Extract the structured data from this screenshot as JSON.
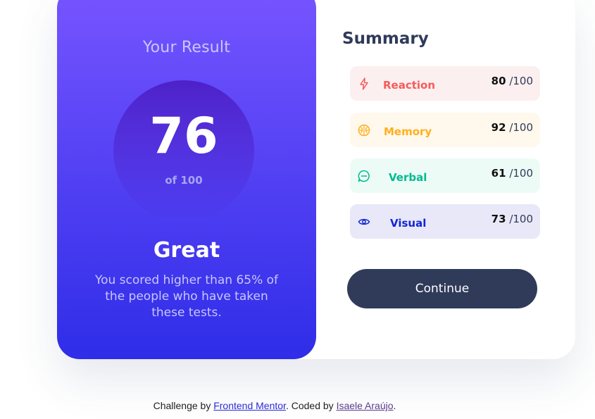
{
  "result": {
    "title": "Your Result",
    "score": "76",
    "max": "of 100",
    "label": "Great",
    "description": "You scored higher than 65% of the people who have taken these tests."
  },
  "summary": {
    "title": "Summary",
    "items": [
      {
        "label": "Reaction",
        "score": "80",
        "max": "/100",
        "icon": "lightning-icon",
        "color": "#f55b5b",
        "bg": "#fcefef"
      },
      {
        "label": "Memory",
        "score": "92",
        "max": "/100",
        "icon": "brain-icon",
        "color": "#ffb01f",
        "bg": "#fff8ec"
      },
      {
        "label": "Verbal",
        "score": "61",
        "max": "/100",
        "icon": "chat-bubble-icon",
        "color": "#00bb8f",
        "bg": "#edfbf6"
      },
      {
        "label": "Visual",
        "score": "73",
        "max": "/100",
        "icon": "eye-icon",
        "color": "#1125d6",
        "bg": "#e8e8f8"
      }
    ],
    "continue_label": "Continue"
  },
  "footer": {
    "prefix": "Challenge by ",
    "link1": "Frontend Mentor",
    "middle": ". Coded by ",
    "link2": "Isaele Araújo",
    "suffix": "."
  }
}
